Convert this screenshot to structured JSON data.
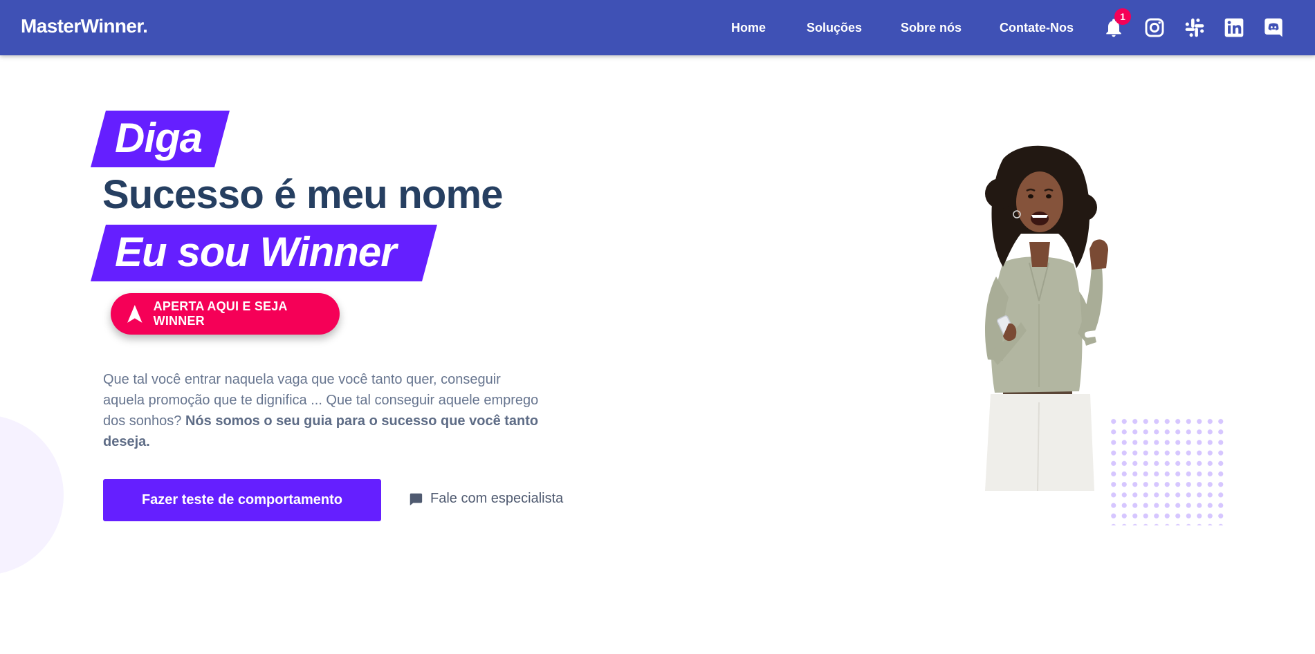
{
  "nav": {
    "brand": "MasterWinner.",
    "links": [
      "Home",
      "Soluções",
      "Sobre nós",
      "Contate-Nos"
    ],
    "notification_count": "1",
    "icons": [
      "bell-icon",
      "instagram-icon",
      "slack-icon",
      "linkedin-icon",
      "discord-icon"
    ]
  },
  "hero": {
    "highlight_1": "Diga",
    "headline": "Sucesso é meu nome",
    "highlight_2": "Eu sou Winner",
    "cta_label": "APERTA AQUI E SEJA WINNER",
    "description": "Que tal você entrar naquela vaga que você tanto quer, conseguir aquela promoção que te dignifica ... Que tal conseguir aquele emprego dos sonhos?",
    "description_bold": "Nós somos o seu guia para o sucesso que você tanto deseja.",
    "primary_button": "Fazer teste de comportamento",
    "secondary_button": "Fale com especialista"
  },
  "colors": {
    "navbar": "#3f51b5",
    "accent_purple": "#651fff",
    "accent_pink": "#f50057",
    "headline": "#263f61",
    "body_text": "#67758f"
  }
}
